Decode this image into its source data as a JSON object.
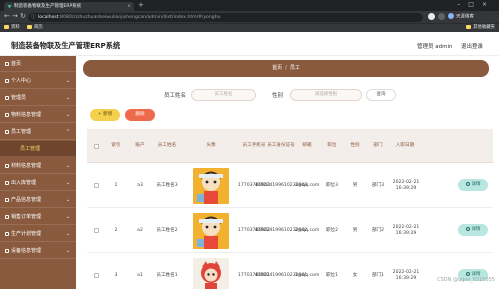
{
  "browser": {
    "tab_title": "制造装备物联及生产管理ERP系统",
    "url_host": "localhost",
    "url_path": ":8080/zizhuzhuanbeiwulianjishengcan/admin/dist/index.html#/yonghu",
    "bookmarks": [
      "资料",
      "简历"
    ],
    "bookmark_other": "其他收藏夹",
    "profile_label": "天涯倦客"
  },
  "app": {
    "title": "制造装备物联及生产管理ERP系统",
    "admin_label": "管理员 admin",
    "logout_label": "退出登录"
  },
  "sidebar": {
    "items": [
      {
        "label": "首页",
        "type": "item"
      },
      {
        "label": "个人中心",
        "type": "group"
      },
      {
        "label": "管理员",
        "type": "group"
      },
      {
        "label": "物料信息管理",
        "type": "group"
      },
      {
        "label": "员工管理",
        "type": "group"
      },
      {
        "label": "员工管理",
        "type": "sub-active"
      },
      {
        "label": "材料信息管理",
        "type": "group"
      },
      {
        "label": "出入库管理",
        "type": "group"
      },
      {
        "label": "产品信息管理",
        "type": "group"
      },
      {
        "label": "销售订单管理",
        "type": "group"
      },
      {
        "label": "生产计划管理",
        "type": "group"
      },
      {
        "label": "设备信息管理",
        "type": "group"
      }
    ]
  },
  "breadcrumb": {
    "home": "首页",
    "separator": "/",
    "current": "员工"
  },
  "search": {
    "name_label": "员工姓名",
    "name_placeholder": "员工姓名",
    "gender_label": "性别",
    "gender_placeholder": "请选择性别",
    "search_button": "查询"
  },
  "actions": {
    "add_label": "+ 新增",
    "delete_label": "删除"
  },
  "table": {
    "headers": [
      "",
      "索引",
      "账户",
      "员工姓名",
      "头像",
      "员工手机号",
      "员工身份证号",
      "邮箱",
      "职位",
      "性别",
      "部门",
      "入职日期",
      ""
    ],
    "rows": [
      {
        "index": "1",
        "account": "a3",
        "name": "员工姓名3",
        "phone": "17703786903",
        "idcard": "410224199610232003",
        "email": "3@qq.com",
        "position": "职位3",
        "gender": "男",
        "dept": "部门3",
        "date": "2022-02-21 16:39:29"
      },
      {
        "index": "2",
        "account": "a2",
        "name": "员工姓名2",
        "phone": "17703786902",
        "idcard": "410224199610232002",
        "email": "2@qq.com",
        "position": "职位2",
        "gender": "男",
        "dept": "部门2",
        "date": "2022-02-21 16:39:29"
      },
      {
        "index": "3",
        "account": "a1",
        "name": "员工姓名1",
        "phone": "17703786901",
        "idcard": "410224199610232001",
        "email": "1@qq.com",
        "position": "职位1",
        "gender": "女",
        "dept": "部门1",
        "date": "2022-02-21 16:39:29"
      }
    ],
    "detail_label": "详情"
  },
  "watermark": "CSDN @qqvx_6310855",
  "colors": {
    "sidebar": "#8a5a3e",
    "add": "#f5d04d",
    "delete": "#ef6a4a",
    "detail": "#b8e6e1"
  }
}
